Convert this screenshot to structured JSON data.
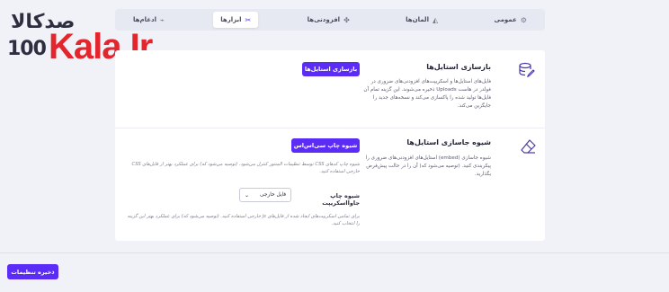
{
  "logo": {
    "fa": "صدکالا",
    "num": "100",
    "brand": "Kala.Ir"
  },
  "tabs": [
    {
      "label": "عمومی",
      "icon": "gear-icon"
    },
    {
      "label": "المان‌ها",
      "icon": "shapes-icon"
    },
    {
      "label": "افزودنی‌ها",
      "icon": "puzzle-icon"
    },
    {
      "label": "ابزارها",
      "icon": "tools-icon",
      "active": true
    },
    {
      "label": "ادغام‌ها",
      "icon": "plug-icon"
    }
  ],
  "section1": {
    "title": "بازسازی استایل‌ها",
    "desc": "فایل‌های استایل‌ها و اسکریپت‌های افزودنی‌های ضروری در فولدر در هاست Uploads ذخیره می‌شوند. این گزینه تمام آن فایل‌ها تولید شده را پاکسازی می‌کند و نسخه‌های جدید را جایگزین می‌کند.",
    "button": "بازسازی استایل‌ها"
  },
  "section2": {
    "title": "شیوه جاسازی استایل‌ها",
    "desc": "شیوه جاسازی (embed) استایل‌های افزودنی‌های ضروری را پیکربندی کنید. (توصیه می‌شود که) آن را در حالت پیش‌فرض بگذارید.",
    "button": "شیوه چاپ سی‌اس‌اس",
    "hint": "شیوه چاپ کدهای CSS توسط تنظیمات المنتور کنترل می‌شود. (توصیه می‌شود که) برای عملکرد بهتر از فایل‌های CSS خارجی استفاده کنید.",
    "js_label": "شیوه چاپ جاوااسکریپت",
    "js_select_value": "فایل خارجی",
    "js_hint": "برای تمامی اسکریپت‌های ایجاد شده از فایل‌های js خارجی استفاده کنید. (توصیه می‌شود که) برای عملکرد بهتر این گزینه را انتخاب کنید."
  },
  "save_button": "ذخیره تنظیمات",
  "colors": {
    "accent": "#5b2cf5",
    "brand_red": "#e3262e",
    "background": "#f1f2f8"
  }
}
